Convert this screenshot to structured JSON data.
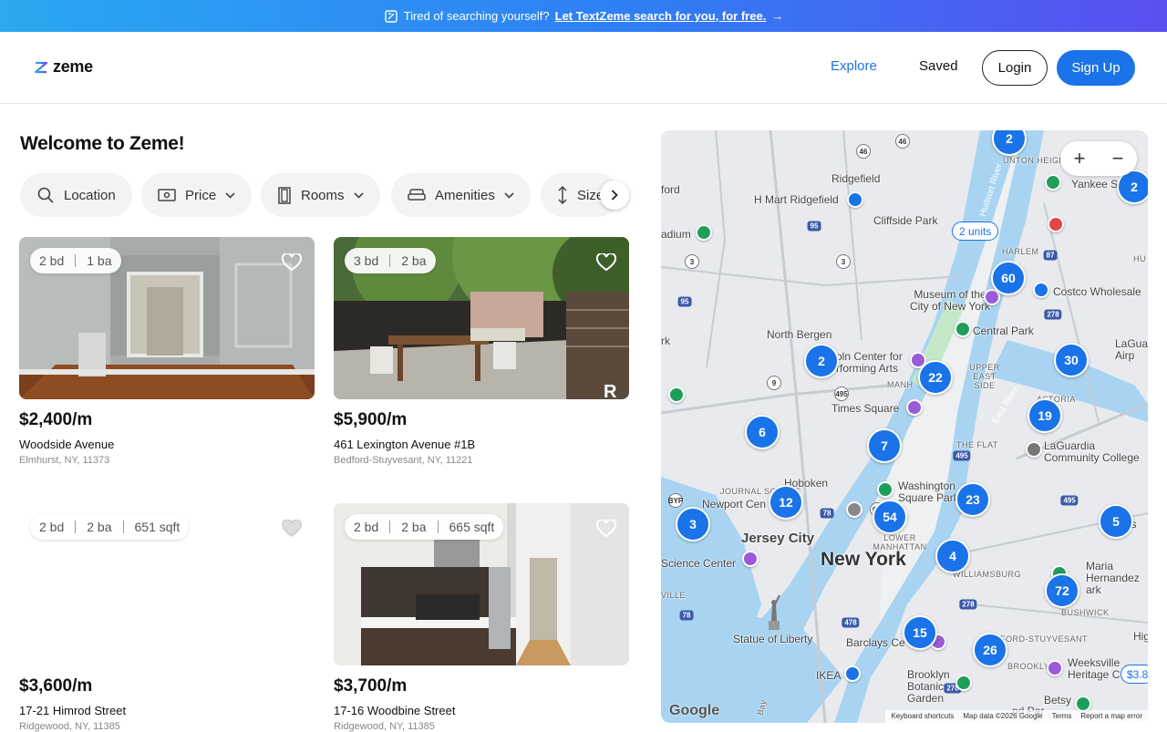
{
  "banner": {
    "text": "Tired of searching yourself?",
    "link": "Let TextZeme search for you, for free.",
    "arrow": "→"
  },
  "header": {
    "logo": "zeme",
    "nav": {
      "explore": "Explore",
      "saved": "Saved"
    },
    "login": "Login",
    "signup": "Sign Up"
  },
  "main": {
    "welcome": "Welcome to Zeme!",
    "filters": [
      "Location",
      "Price",
      "Rooms",
      "Amenities",
      "Size"
    ],
    "listings": [
      {
        "beds": "2 bd",
        "baths": "1 ba",
        "sqft": "",
        "price": "$2,400/m",
        "street": "Woodside Avenue",
        "city": "Elmhurst, NY, 11373",
        "has_photo": true
      },
      {
        "beds": "3 bd",
        "baths": "2 ba",
        "sqft": "",
        "price": "$5,900/m",
        "street": "461 Lexington Avenue #1B",
        "city": "Bedford-Stuyvesant, NY, 11221",
        "has_photo": true
      },
      {
        "beds": "2 bd",
        "baths": "2 ba",
        "sqft": "651 sqft",
        "price": "$3,600/m",
        "street": "17-21 Himrod Street",
        "city": "Ridgewood, NY, 11385",
        "has_photo": false
      },
      {
        "beds": "2 bd",
        "baths": "2 ba",
        "sqft": "665 sqft",
        "price": "$3,700/m",
        "street": "17-16 Woodbine Street",
        "city": "Ridgewood, NY, 11385",
        "has_photo": true
      }
    ]
  },
  "map": {
    "zoom_in": "+",
    "zoom_out": "−",
    "units_pill": "2 units",
    "price_pill": "$3.8",
    "clusters": [
      "2",
      "2",
      "60",
      "2",
      "22",
      "30",
      "6",
      "19",
      "7",
      "12",
      "54",
      "23",
      "3",
      "5",
      "4",
      "72",
      "15",
      "26"
    ],
    "labels": {
      "new_york": "New York",
      "jersey_city": "Jersey City",
      "hoboken": "Hoboken",
      "north_bergen": "North Bergen",
      "ridgefield": "Ridgefield",
      "hmart": "H Mart Ridgefield",
      "cliffside": "Cliffside Park",
      "yankee": "Yankee St",
      "costco": "Costco Wholesale",
      "museum": "Museum of the City of New York",
      "central_park": "Central Park",
      "lincoln": "oln Center for rforming Arts",
      "times_square": "Times Square",
      "manhattan": "MANH",
      "upper_east": "UPPER EAST SIDE",
      "astoria": "ASTORIA",
      "laguardia": "LaGuardia Community College",
      "washington_sq": "Washington Square Park",
      "newport": "Newport Cen",
      "journal_sq": "JOURNAL SQUARE",
      "science": "Science Center",
      "lower_manhattan": "LOWER MANHATTAN",
      "williamsburg": "WILLIAMSBURG",
      "maria": "Maria Hernandez ark",
      "bushwick": "BUSHWICK",
      "statue": "Statue of Liberty",
      "barclays": "Barclays Ce",
      "bed_stuy": "BEDFORD-STUYVESANT",
      "brooklyn": "BROOKLYN",
      "weeksville": "Weeksville Heritage C",
      "ikea": "IKEA",
      "botanic": "Brooklyn Botanic Garden",
      "betsy": "Betsy",
      "harlem": "HARLEM",
      "hudson": "Hudson River",
      "east_river": "East River",
      "laguardia_airport": "LaGuar Airp",
      "highland": "Highlar",
      "ord": "ford",
      "adium": "adium",
      "rk": "rk",
      "ville": "VILLE",
      "the_flat": "THE FLAT",
      "heights": "UNTON HEIGHTS",
      "hu": "HU",
      "bay": "Bay",
      "res": "res",
      "nd_park": "nd Par"
    },
    "google": "Google",
    "attribution": [
      "Keyboard shortcuts",
      "Map data ©2026 Google",
      "Terms",
      "Report a map error"
    ]
  },
  "colors": {
    "accent": "#1a73e8",
    "water": "#a8d4f2",
    "land": "#e8eaed",
    "park": "#c4e8c8"
  }
}
